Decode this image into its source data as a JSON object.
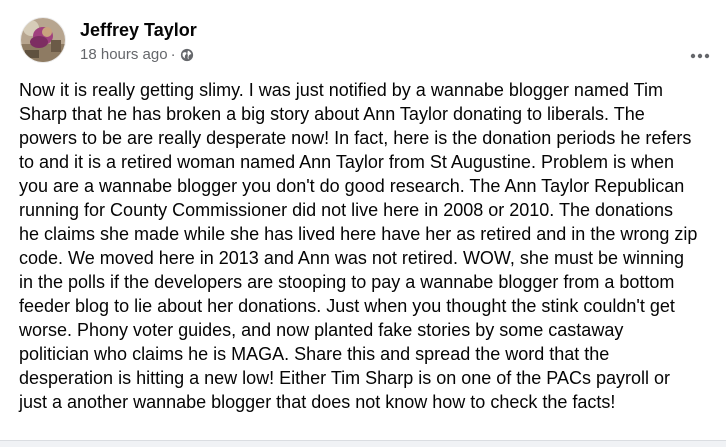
{
  "post": {
    "author": "Jeffrey Taylor",
    "timestamp": "18 hours ago",
    "separator": "·",
    "audience_icon": "globe-icon",
    "more_icon": "more-options-icon",
    "text": "Now it is really getting slimy. I was just notified by a wannabe blogger named Tim\nSharp that he has broken a big story about Ann Taylor donating to liberals. The\npowers to be are really desperate now! In fact, here is the donation periods he refers\nto and it is a retired woman named Ann Taylor from St Augustine. Problem is when\nyou are a wannabe blogger you don't do good research. The Ann Taylor Republican\nrunning for County Commissioner did not live here in 2008 or 2010. The donations\nhe claims she made while she has lived here have her as retired and in the wrong zip\ncode. We moved here in 2013 and Ann was not retired. WOW, she must be winning\nin the polls if the developers are stooping to pay a wannabe blogger from a bottom\nfeeder blog to lie about her donations. Just when you thought the stink couldn't get\nworse. Phony voter guides, and now planted fake stories by some castaway\npolitician who claims he is MAGA. Share this and spread the word that the\ndesperation is hitting a new low! Either Tim Sharp is on one of the PACs payroll or\njust a another wannabe blogger that does not know how to check the facts!"
  },
  "colors": {
    "text_primary": "#050505",
    "text_secondary": "#65676b",
    "background": "#ffffff"
  }
}
